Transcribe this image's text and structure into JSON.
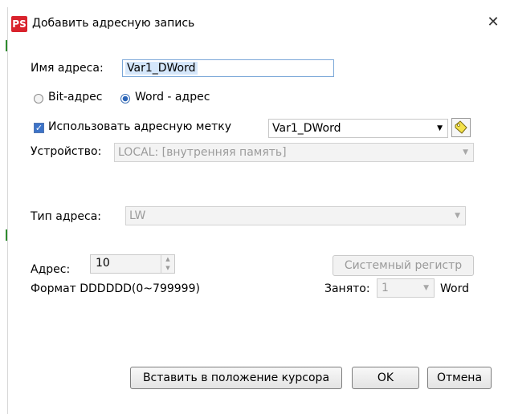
{
  "window": {
    "title": "Добавить адресную запись",
    "close_label": "✕",
    "app_icon_text": "PS"
  },
  "address_name": {
    "label": "Имя адреса:",
    "value": "Var1_DWord"
  },
  "address_type_radio": {
    "bit_label": "Bit-адрес",
    "word_label": "Word - адрес",
    "selected": "word"
  },
  "address_tag": {
    "checkbox_label": "Использовать адресную метку",
    "checked": true,
    "value": "Var1_DWord"
  },
  "device": {
    "label": "Устройство:",
    "value": "LOCAL: [внутренняя память]"
  },
  "addr_kind": {
    "label": "Тип адреса:",
    "value": "LW"
  },
  "address": {
    "label": "Адрес:",
    "value": "10",
    "format": "Формат DDDDDD(0~799999)"
  },
  "system_register_button": "Системный регистр",
  "occupied": {
    "label": "Занято:",
    "value": "1",
    "unit": "Word"
  },
  "buttons": {
    "insert_at_cursor": "Вставить в положение курсора",
    "ok": "OK",
    "cancel": "Отмена"
  },
  "icons": {
    "app": "ps-app-icon",
    "close": "close-icon",
    "tag": "tag-icon",
    "combo_arrow": "chevron-down-icon"
  },
  "colors": {
    "accent": "#3c73c8",
    "app_icon": "#d9232d",
    "selection": "#d5e7fb"
  }
}
